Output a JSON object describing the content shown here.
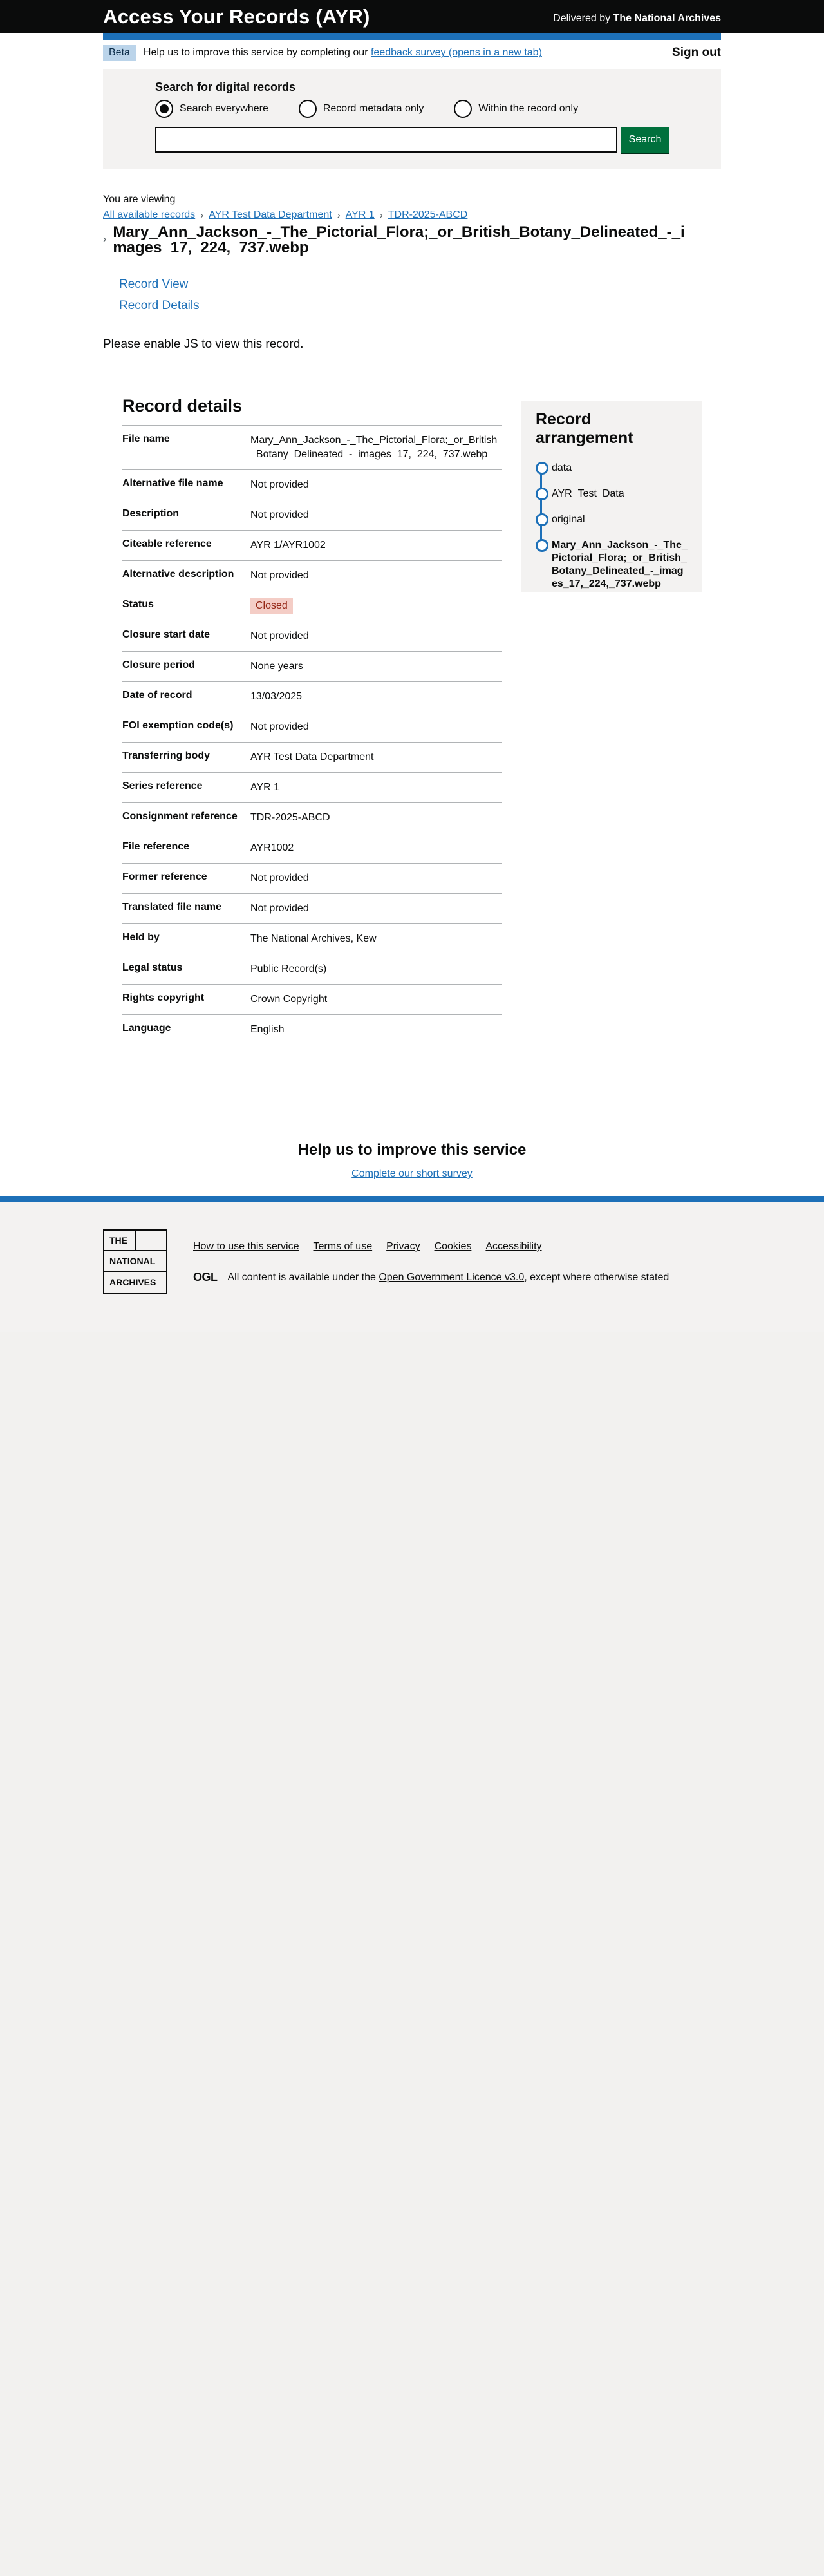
{
  "header": {
    "title": "Access Your Records (AYR)",
    "delivered_prefix": "Delivered by",
    "delivered_by": "The National Archives"
  },
  "phase": {
    "tag": "Beta",
    "text": "Help us to improve this service by completing our",
    "link": "feedback survey (opens in a new tab)",
    "sign_out": "Sign out"
  },
  "search": {
    "label": "Search for digital records",
    "options": [
      "Search everywhere",
      "Record metadata only",
      "Within the record only"
    ],
    "selected": "Search everywhere",
    "value": "",
    "button": "Search"
  },
  "breadcrumbs": {
    "viewing": "You are viewing",
    "items": [
      "All available records",
      "AYR Test Data Department",
      "AYR 1",
      "TDR-2025-ABCD"
    ],
    "current": "Mary_Ann_Jackson_-_The_Pictorial_Flora;_or_British_Botany_Delineated_-_images_17,_224,_737.webp"
  },
  "record_links": [
    "Record View",
    "Record Details"
  ],
  "enable_js": "Please enable JS to view this record.",
  "details": {
    "heading": "Record details",
    "rows": [
      {
        "key": "File name",
        "value": "Mary_Ann_Jackson_-_The_Pictorial_Flora;_or_British_Botany_Delineated_-_images_17,_224,_737.webp"
      },
      {
        "key": "Alternative file name",
        "value": "Not provided"
      },
      {
        "key": "Description",
        "value": "Not provided"
      },
      {
        "key": "Citeable reference",
        "value": "AYR 1/AYR1002"
      },
      {
        "key": "Alternative description",
        "value": "Not provided"
      },
      {
        "key": "Status",
        "value": "Closed"
      },
      {
        "key": "Closure start date",
        "value": "Not provided"
      },
      {
        "key": "Closure period",
        "value": "None years"
      },
      {
        "key": "Date of record",
        "value": "13/03/2025"
      },
      {
        "key": "FOI exemption code(s)",
        "value": "Not provided"
      },
      {
        "key": "Transferring body",
        "value": "AYR Test Data Department"
      },
      {
        "key": "Series reference",
        "value": "AYR 1"
      },
      {
        "key": "Consignment reference",
        "value": "TDR-2025-ABCD"
      },
      {
        "key": "File reference",
        "value": "AYR1002"
      },
      {
        "key": "Former reference",
        "value": "Not provided"
      },
      {
        "key": "Translated file name",
        "value": "Not provided"
      },
      {
        "key": "Held by",
        "value": "The National Archives, Kew"
      },
      {
        "key": "Legal status",
        "value": "Public Record(s)"
      },
      {
        "key": "Rights copyright",
        "value": "Crown Copyright"
      },
      {
        "key": "Language",
        "value": "English"
      }
    ]
  },
  "arrangement": {
    "heading": "Record arrangement",
    "items": [
      "data",
      "AYR_Test_Data",
      "original",
      "Mary_Ann_Jackson_-_The_Pictorial_Flora;_or_British_Botany_Delineated_-_images_17,_224,_737.webp"
    ]
  },
  "survey": {
    "heading": "Help us to improve this service",
    "link": "Complete our short survey"
  },
  "footer": {
    "logo": [
      "THE",
      "NATIONAL",
      "ARCHIVES"
    ],
    "links": [
      "How to use this service",
      "Terms of use",
      "Privacy",
      "Cookies",
      "Accessibility"
    ],
    "ogl": "OGL",
    "licence_prefix": "All content is available under the",
    "licence_link": "Open Government Licence v3.0",
    "licence_suffix": ", except where otherwise stated"
  },
  "colors": {
    "header_bg": "#0b0c0c",
    "brand_blue": "#1d70b8",
    "search_green": "#00703c",
    "closed_tag_bg": "#f4cdc6"
  }
}
